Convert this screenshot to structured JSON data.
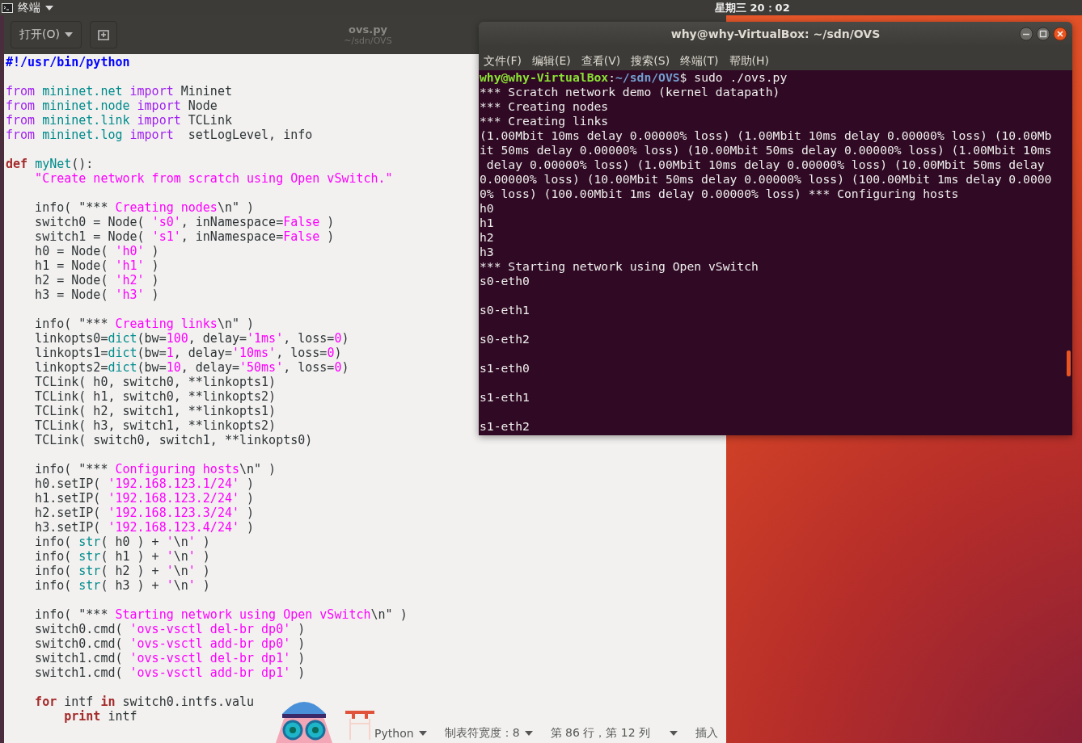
{
  "top_bar": {
    "app_menu": "终端",
    "clock": "星期三 20：02"
  },
  "editor": {
    "open_button": "打开(O)",
    "title": "ovs.py",
    "subtitle": "~/sdn/OVS",
    "code": [
      {
        "kind": "code",
        "tokens": [
          {
            "kind": "shebang",
            "text": "#!/usr/bin/python"
          }
        ]
      },
      {
        "kind": "blank"
      },
      {
        "kind": "code",
        "tokens": [
          {
            "kind": "imp",
            "text": "from "
          },
          {
            "kind": "mod",
            "text": "mininet.net "
          },
          {
            "kind": "imp",
            "text": "import "
          },
          {
            "kind": "plain",
            "text": "Mininet"
          }
        ]
      },
      {
        "kind": "code",
        "tokens": [
          {
            "kind": "imp",
            "text": "from "
          },
          {
            "kind": "mod",
            "text": "mininet.node "
          },
          {
            "kind": "imp",
            "text": "import "
          },
          {
            "kind": "plain",
            "text": "Node"
          }
        ]
      },
      {
        "kind": "code",
        "tokens": [
          {
            "kind": "imp",
            "text": "from "
          },
          {
            "kind": "mod",
            "text": "mininet.link "
          },
          {
            "kind": "imp",
            "text": "import "
          },
          {
            "kind": "plain",
            "text": "TCLink"
          }
        ]
      },
      {
        "kind": "code",
        "tokens": [
          {
            "kind": "imp",
            "text": "from "
          },
          {
            "kind": "mod",
            "text": "mininet.log "
          },
          {
            "kind": "imp",
            "text": "import "
          },
          {
            "kind": "plain",
            "text": " setLogLevel, info"
          }
        ]
      },
      {
        "kind": "blank"
      },
      {
        "kind": "code",
        "tokens": [
          {
            "kind": "kw",
            "text": "def "
          },
          {
            "kind": "fn",
            "text": "myNet"
          },
          {
            "kind": "plain",
            "text": "():"
          }
        ]
      },
      {
        "kind": "code",
        "tokens": [
          {
            "kind": "str",
            "text": "    \"Create network from scratch using Open vSwitch.\""
          }
        ]
      },
      {
        "kind": "blank"
      },
      {
        "kind": "code",
        "tokens": [
          {
            "kind": "plain",
            "text": "    info( \"*** "
          },
          {
            "kind": "str",
            "text": "Creating nodes"
          },
          {
            "kind": "plain",
            "text": "\\n\" )"
          }
        ]
      },
      {
        "kind": "code",
        "tokens": [
          {
            "kind": "plain",
            "text": "    switch0 = Node( "
          },
          {
            "kind": "str",
            "text": "'s0'"
          },
          {
            "kind": "plain",
            "text": ", inNamespace="
          },
          {
            "kind": "const",
            "text": "False"
          },
          {
            "kind": "plain",
            "text": " )"
          }
        ]
      },
      {
        "kind": "code",
        "tokens": [
          {
            "kind": "plain",
            "text": "    switch1 = Node( "
          },
          {
            "kind": "str",
            "text": "'s1'"
          },
          {
            "kind": "plain",
            "text": ", inNamespace="
          },
          {
            "kind": "const",
            "text": "False"
          },
          {
            "kind": "plain",
            "text": " )"
          }
        ]
      },
      {
        "kind": "code",
        "tokens": [
          {
            "kind": "plain",
            "text": "    h0 = Node( "
          },
          {
            "kind": "str",
            "text": "'h0'"
          },
          {
            "kind": "plain",
            "text": " )"
          }
        ]
      },
      {
        "kind": "code",
        "tokens": [
          {
            "kind": "plain",
            "text": "    h1 = Node( "
          },
          {
            "kind": "str",
            "text": "'h1'"
          },
          {
            "kind": "plain",
            "text": " )"
          }
        ]
      },
      {
        "kind": "code",
        "tokens": [
          {
            "kind": "plain",
            "text": "    h2 = Node( "
          },
          {
            "kind": "str",
            "text": "'h2'"
          },
          {
            "kind": "plain",
            "text": " )"
          }
        ]
      },
      {
        "kind": "code",
        "tokens": [
          {
            "kind": "plain",
            "text": "    h3 = Node( "
          },
          {
            "kind": "str",
            "text": "'h3'"
          },
          {
            "kind": "plain",
            "text": " )"
          }
        ]
      },
      {
        "kind": "blank"
      },
      {
        "kind": "code",
        "tokens": [
          {
            "kind": "plain",
            "text": "    info( \"*** "
          },
          {
            "kind": "str",
            "text": "Creating links"
          },
          {
            "kind": "plain",
            "text": "\\n\" )"
          }
        ]
      },
      {
        "kind": "code",
        "tokens": [
          {
            "kind": "plain",
            "text": "    linkopts0="
          },
          {
            "kind": "fn",
            "text": "dict"
          },
          {
            "kind": "plain",
            "text": "(bw="
          },
          {
            "kind": "num",
            "text": "100"
          },
          {
            "kind": "plain",
            "text": ", delay="
          },
          {
            "kind": "str",
            "text": "'1ms'"
          },
          {
            "kind": "plain",
            "text": ", loss="
          },
          {
            "kind": "num",
            "text": "0"
          },
          {
            "kind": "plain",
            "text": ")"
          }
        ]
      },
      {
        "kind": "code",
        "tokens": [
          {
            "kind": "plain",
            "text": "    linkopts1="
          },
          {
            "kind": "fn",
            "text": "dict"
          },
          {
            "kind": "plain",
            "text": "(bw="
          },
          {
            "kind": "num",
            "text": "1"
          },
          {
            "kind": "plain",
            "text": ", delay="
          },
          {
            "kind": "str",
            "text": "'10ms'"
          },
          {
            "kind": "plain",
            "text": ", loss="
          },
          {
            "kind": "num",
            "text": "0"
          },
          {
            "kind": "plain",
            "text": ")"
          }
        ]
      },
      {
        "kind": "code",
        "tokens": [
          {
            "kind": "plain",
            "text": "    linkopts2="
          },
          {
            "kind": "fn",
            "text": "dict"
          },
          {
            "kind": "plain",
            "text": "(bw="
          },
          {
            "kind": "num",
            "text": "10"
          },
          {
            "kind": "plain",
            "text": ", delay="
          },
          {
            "kind": "str",
            "text": "'50ms'"
          },
          {
            "kind": "plain",
            "text": ", loss="
          },
          {
            "kind": "num",
            "text": "0"
          },
          {
            "kind": "plain",
            "text": ")"
          }
        ]
      },
      {
        "kind": "code",
        "tokens": [
          {
            "kind": "plain",
            "text": "    TCLink( h0, switch0, **linkopts1)"
          }
        ]
      },
      {
        "kind": "code",
        "tokens": [
          {
            "kind": "plain",
            "text": "    TCLink( h1, switch0, **linkopts2)"
          }
        ]
      },
      {
        "kind": "code",
        "tokens": [
          {
            "kind": "plain",
            "text": "    TCLink( h2, switch1, **linkopts1)"
          }
        ]
      },
      {
        "kind": "code",
        "tokens": [
          {
            "kind": "plain",
            "text": "    TCLink( h3, switch1, **linkopts2)"
          }
        ]
      },
      {
        "kind": "code",
        "tokens": [
          {
            "kind": "plain",
            "text": "    TCLink( switch0, switch1, **linkopts0)"
          }
        ]
      },
      {
        "kind": "blank"
      },
      {
        "kind": "code",
        "tokens": [
          {
            "kind": "plain",
            "text": "    info( \"*** "
          },
          {
            "kind": "str",
            "text": "Configuring hosts"
          },
          {
            "kind": "plain",
            "text": "\\n\" )"
          }
        ]
      },
      {
        "kind": "code",
        "tokens": [
          {
            "kind": "plain",
            "text": "    h0.setIP( "
          },
          {
            "kind": "str",
            "text": "'192.168.123.1/24'"
          },
          {
            "kind": "plain",
            "text": " )"
          }
        ]
      },
      {
        "kind": "code",
        "tokens": [
          {
            "kind": "plain",
            "text": "    h1.setIP( "
          },
          {
            "kind": "str",
            "text": "'192.168.123.2/24'"
          },
          {
            "kind": "plain",
            "text": " )"
          }
        ]
      },
      {
        "kind": "code",
        "tokens": [
          {
            "kind": "plain",
            "text": "    h2.setIP( "
          },
          {
            "kind": "str",
            "text": "'192.168.123.3/24'"
          },
          {
            "kind": "plain",
            "text": " )"
          }
        ]
      },
      {
        "kind": "code",
        "tokens": [
          {
            "kind": "plain",
            "text": "    h3.setIP( "
          },
          {
            "kind": "str",
            "text": "'192.168.123.4/24'"
          },
          {
            "kind": "plain",
            "text": " )"
          }
        ]
      },
      {
        "kind": "code",
        "tokens": [
          {
            "kind": "plain",
            "text": "    info( "
          },
          {
            "kind": "fn",
            "text": "str"
          },
          {
            "kind": "plain",
            "text": "( h0 ) + "
          },
          {
            "kind": "str",
            "text": "'"
          },
          {
            "kind": "plain",
            "text": "\\n"
          },
          {
            "kind": "str",
            "text": "'"
          },
          {
            "kind": "plain",
            "text": " )"
          }
        ]
      },
      {
        "kind": "code",
        "tokens": [
          {
            "kind": "plain",
            "text": "    info( "
          },
          {
            "kind": "fn",
            "text": "str"
          },
          {
            "kind": "plain",
            "text": "( h1 ) + "
          },
          {
            "kind": "str",
            "text": "'"
          },
          {
            "kind": "plain",
            "text": "\\n"
          },
          {
            "kind": "str",
            "text": "'"
          },
          {
            "kind": "plain",
            "text": " )"
          }
        ]
      },
      {
        "kind": "code",
        "tokens": [
          {
            "kind": "plain",
            "text": "    info( "
          },
          {
            "kind": "fn",
            "text": "str"
          },
          {
            "kind": "plain",
            "text": "( h2 ) + "
          },
          {
            "kind": "str",
            "text": "'"
          },
          {
            "kind": "plain",
            "text": "\\n"
          },
          {
            "kind": "str",
            "text": "'"
          },
          {
            "kind": "plain",
            "text": " )"
          }
        ]
      },
      {
        "kind": "code",
        "tokens": [
          {
            "kind": "plain",
            "text": "    info( "
          },
          {
            "kind": "fn",
            "text": "str"
          },
          {
            "kind": "plain",
            "text": "( h3 ) + "
          },
          {
            "kind": "str",
            "text": "'"
          },
          {
            "kind": "plain",
            "text": "\\n"
          },
          {
            "kind": "str",
            "text": "'"
          },
          {
            "kind": "plain",
            "text": " )"
          }
        ]
      },
      {
        "kind": "blank"
      },
      {
        "kind": "code",
        "tokens": [
          {
            "kind": "plain",
            "text": "    info( \"*** "
          },
          {
            "kind": "str",
            "text": "Starting network using Open vSwitch"
          },
          {
            "kind": "plain",
            "text": "\\n\" )"
          }
        ]
      },
      {
        "kind": "code",
        "tokens": [
          {
            "kind": "plain",
            "text": "    switch0.cmd( "
          },
          {
            "kind": "str",
            "text": "'ovs-vsctl del-br dp0'"
          },
          {
            "kind": "plain",
            "text": " )"
          }
        ]
      },
      {
        "kind": "code",
        "tokens": [
          {
            "kind": "plain",
            "text": "    switch0.cmd( "
          },
          {
            "kind": "str",
            "text": "'ovs-vsctl add-br dp0'"
          },
          {
            "kind": "plain",
            "text": " )"
          }
        ]
      },
      {
        "kind": "code",
        "tokens": [
          {
            "kind": "plain",
            "text": "    switch1.cmd( "
          },
          {
            "kind": "str",
            "text": "'ovs-vsctl del-br dp1'"
          },
          {
            "kind": "plain",
            "text": " )"
          }
        ]
      },
      {
        "kind": "code",
        "tokens": [
          {
            "kind": "plain",
            "text": "    switch1.cmd( "
          },
          {
            "kind": "str",
            "text": "'ovs-vsctl add-br dp1'"
          },
          {
            "kind": "plain",
            "text": " )"
          }
        ]
      },
      {
        "kind": "blank"
      },
      {
        "kind": "code",
        "tokens": [
          {
            "kind": "kw",
            "text": "    for"
          },
          {
            "kind": "plain",
            "text": " intf "
          },
          {
            "kind": "kw",
            "text": "in"
          },
          {
            "kind": "plain",
            "text": " switch0.intfs.valu"
          }
        ]
      },
      {
        "kind": "code",
        "tokens": [
          {
            "kind": "kw",
            "text": "        print"
          },
          {
            "kind": "plain",
            "text": " intf"
          }
        ]
      }
    ],
    "status_bar": {
      "language": "Python",
      "tab_width": "制表符宽度：8",
      "position": "第 86 行，第 12 列",
      "mode": "插入"
    }
  },
  "terminal": {
    "title": "why@why-VirtualBox: ~/sdn/OVS",
    "menu": [
      "文件(F)",
      "编辑(E)",
      "查看(V)",
      "搜索(S)",
      "终端(T)",
      "帮助(H)"
    ],
    "prompt": {
      "user_host": "why@why-VirtualBox",
      "separator": ":",
      "path": "~/sdn/OVS",
      "command": "$ sudo ./ovs.py"
    },
    "output": [
      {
        "kind": "line",
        "text": "*** Scratch network demo (kernel datapath)"
      },
      {
        "kind": "line",
        "text": "*** Creating nodes"
      },
      {
        "kind": "line",
        "text": "*** Creating links"
      },
      {
        "kind": "line",
        "text": "(1.00Mbit 10ms delay 0.00000% loss) (1.00Mbit 10ms delay 0.00000% loss) (10.00Mb"
      },
      {
        "kind": "line",
        "text": "it 50ms delay 0.00000% loss) (10.00Mbit 50ms delay 0.00000% loss) (1.00Mbit 10ms"
      },
      {
        "kind": "line",
        "text": " delay 0.00000% loss) (1.00Mbit 10ms delay 0.00000% loss) (10.00Mbit 50ms delay"
      },
      {
        "kind": "line",
        "text": "0.00000% loss) (10.00Mbit 50ms delay 0.00000% loss) (100.00Mbit 1ms delay 0.0000"
      },
      {
        "kind": "line",
        "text": "0% loss) (100.00Mbit 1ms delay 0.00000% loss) *** Configuring hosts"
      },
      {
        "kind": "line",
        "text": "h0"
      },
      {
        "kind": "line",
        "text": "h1"
      },
      {
        "kind": "line",
        "text": "h2"
      },
      {
        "kind": "line",
        "text": "h3"
      },
      {
        "kind": "line",
        "text": "*** Starting network using Open vSwitch"
      },
      {
        "kind": "line",
        "text": "s0-eth0"
      },
      {
        "kind": "blank"
      },
      {
        "kind": "line",
        "text": "s0-eth1"
      },
      {
        "kind": "blank"
      },
      {
        "kind": "line",
        "text": "s0-eth2"
      },
      {
        "kind": "blank"
      },
      {
        "kind": "line",
        "text": "s1-eth0"
      },
      {
        "kind": "blank"
      },
      {
        "kind": "line",
        "text": "s1-eth1"
      },
      {
        "kind": "blank"
      },
      {
        "kind": "line",
        "text": "s1-eth2"
      }
    ]
  }
}
